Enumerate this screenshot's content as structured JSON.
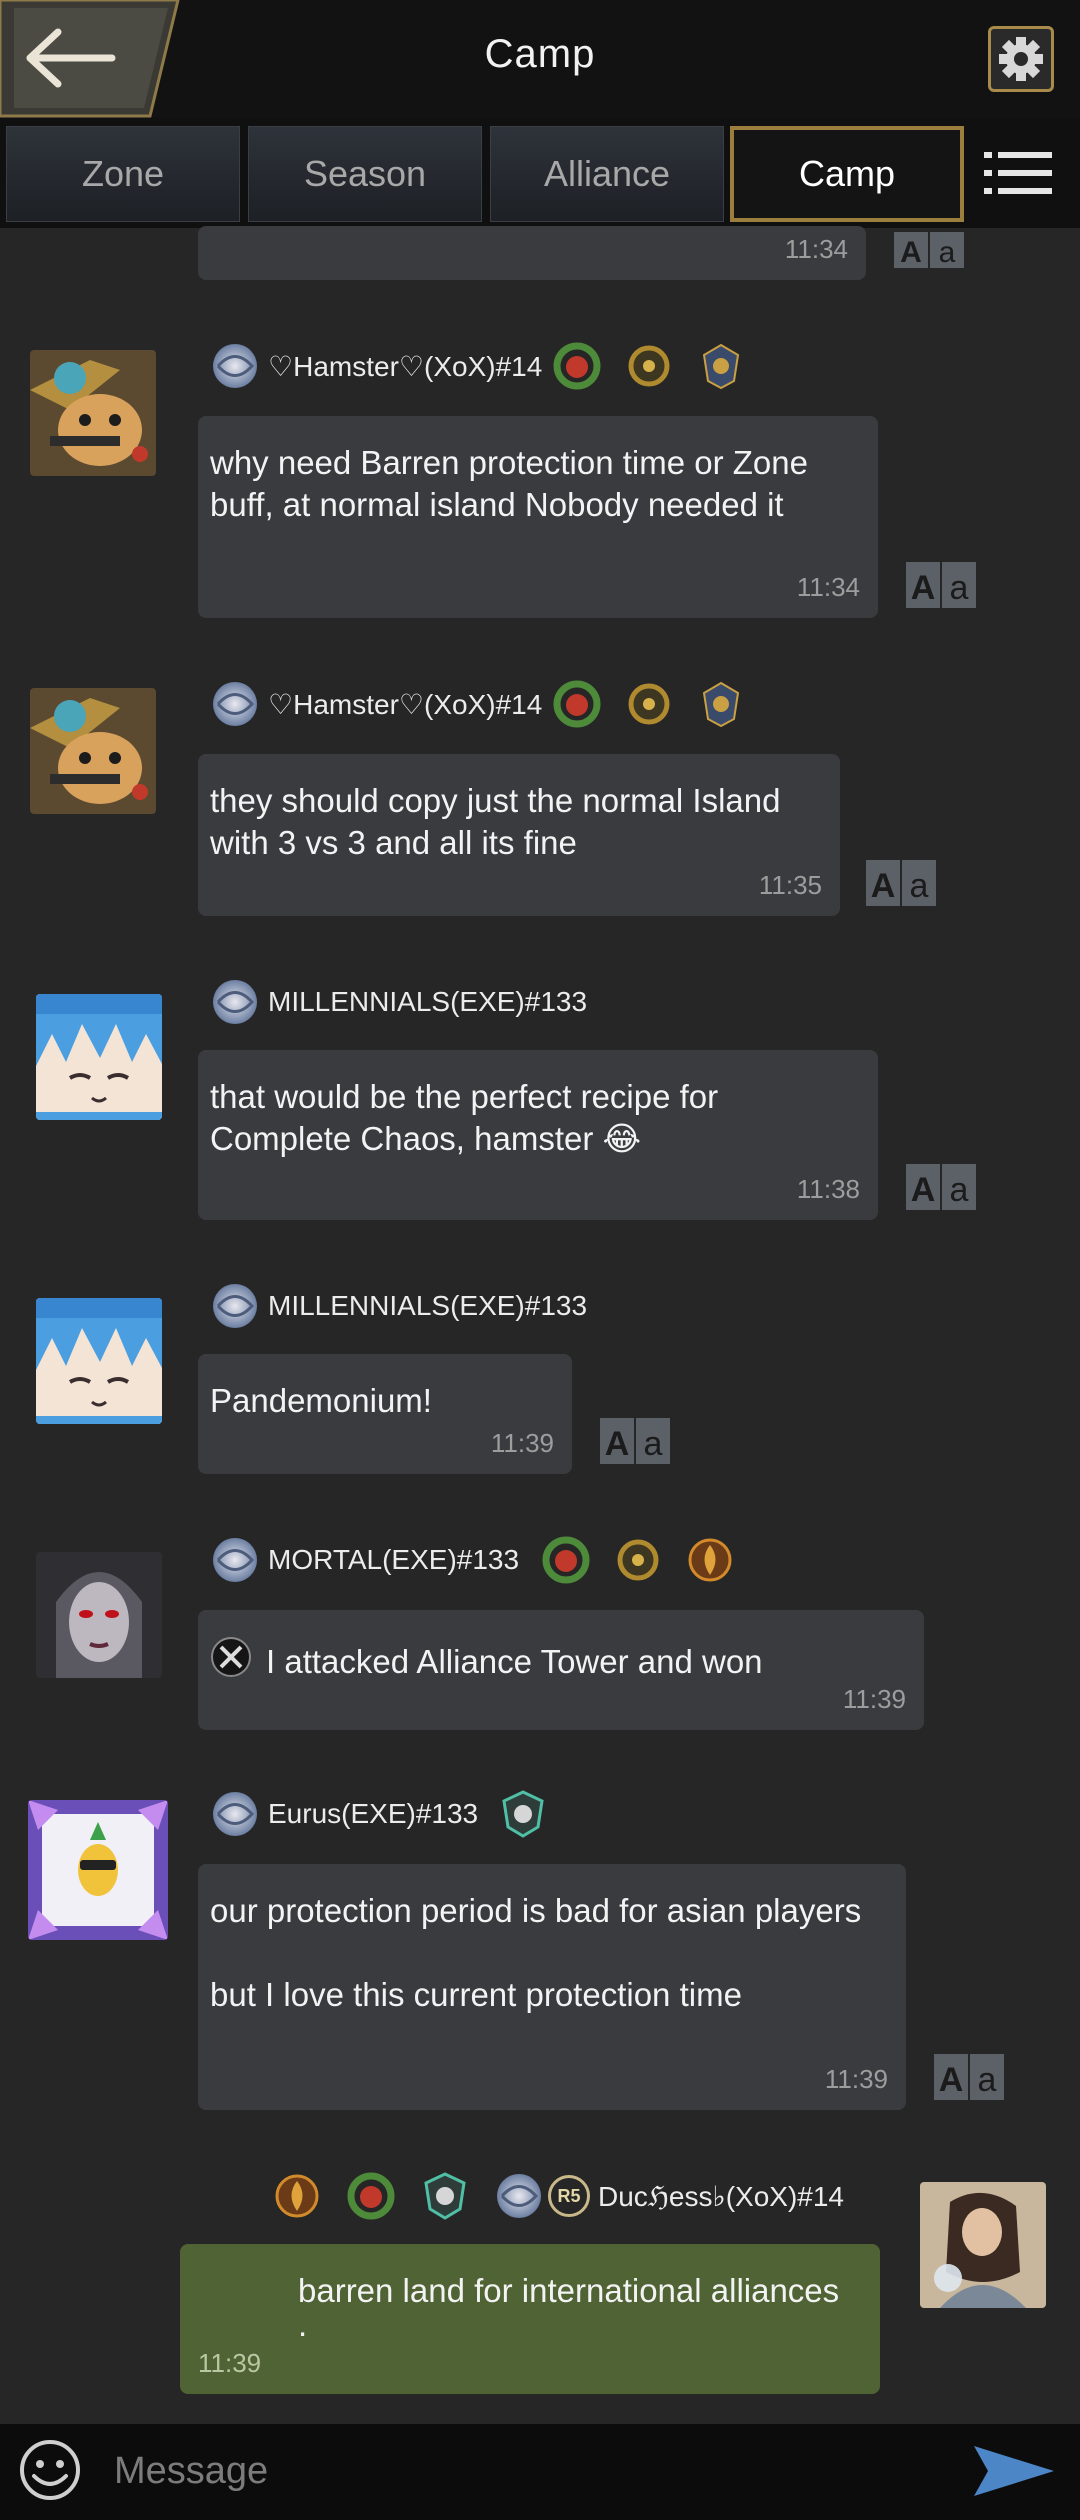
{
  "header": {
    "title": "Camp",
    "back_icon": "back-arrow-icon",
    "settings_icon": "gear-icon",
    "menu_icon": "list-menu-icon"
  },
  "tabs": [
    {
      "label": "Zone",
      "active": false
    },
    {
      "label": "Season",
      "active": false
    },
    {
      "label": "Alliance",
      "active": false
    },
    {
      "label": "Camp",
      "active": true
    }
  ],
  "colors": {
    "accent_gold": "#9b7d3e",
    "bubble": "#3a3b3e",
    "my_bubble": "#4f6334",
    "background": "#262626"
  },
  "messages": [
    {
      "time": "11:34"
    },
    {
      "sender": "♡Hamster♡(XoX)#14",
      "text": "why need Barren protection time or Zone buff, at normal island Nobody needed it",
      "time": "11:34"
    },
    {
      "sender": "♡Hamster♡(XoX)#14",
      "text": "they should copy just the normal Island with 3 vs 3 and all its fine",
      "time": "11:35"
    },
    {
      "sender": "MILLENNIALS(EXE)#133",
      "text": "that would be the perfect recipe for Complete Chaos, hamster 😂",
      "time": "11:38"
    },
    {
      "sender": "MILLENNIALS(EXE)#133",
      "text": "Pandemonium!",
      "time": "11:39"
    },
    {
      "sender": "MORTAL(EXE)#133",
      "text": "I attacked Alliance Tower and won",
      "time": "11:39"
    },
    {
      "sender": "Eurus(EXE)#133",
      "text": "our protection period is bad for asian players",
      "text2": "but I love this current protection time",
      "time": "11:39"
    },
    {
      "sender": "Ducℌess♭(XoX)#14",
      "rank": "R5",
      "text": "barren land for international alliances",
      "text_cont": ".",
      "time": "11:39"
    }
  ],
  "footer": {
    "placeholder": "Message",
    "emoji_icon": "smiley-icon",
    "send_icon": "send-arrow-icon"
  }
}
